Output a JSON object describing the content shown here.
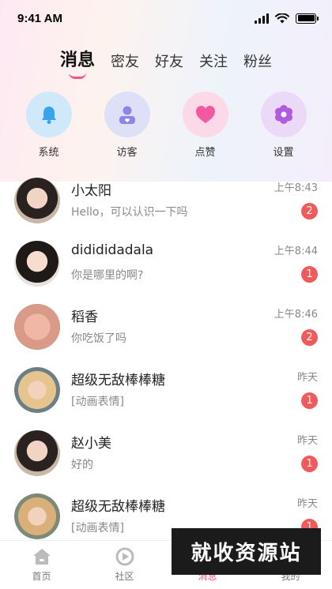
{
  "status_bar": {
    "time": "9:41 AM"
  },
  "tabs": [
    {
      "label": "消息",
      "active": true
    },
    {
      "label": "密友",
      "active": false
    },
    {
      "label": "好友",
      "active": false
    },
    {
      "label": "关注",
      "active": false
    },
    {
      "label": "粉丝",
      "active": false
    }
  ],
  "quick_actions": [
    {
      "label": "系统",
      "icon": "bell-icon"
    },
    {
      "label": "访客",
      "icon": "visitor-icon"
    },
    {
      "label": "点赞",
      "icon": "heart-icon"
    },
    {
      "label": "设置",
      "icon": "gear-icon"
    }
  ],
  "conversations": [
    {
      "name": "小太阳",
      "message": "Hello，可以认识一下吗",
      "time": "上午8:43",
      "unread": "2"
    },
    {
      "name": "didididadala",
      "message": "你是哪里的啊?",
      "time": "上午8:44",
      "unread": "1"
    },
    {
      "name": "稻香",
      "message": "你吃饭了吗",
      "time": "上午8:46",
      "unread": "2"
    },
    {
      "name": "超级无敌棒棒糖",
      "message": "[动画表情]",
      "time": "昨天",
      "unread": "1"
    },
    {
      "name": "赵小美",
      "message": "好的",
      "time": "昨天",
      "unread": "1"
    },
    {
      "name": "超级无敌棒棒糖",
      "message": "[动画表情]",
      "time": "昨天",
      "unread": "1"
    }
  ],
  "tabbar": [
    {
      "label": "首页",
      "icon": "home-icon"
    },
    {
      "label": "社区",
      "icon": "community-icon"
    },
    {
      "label": "消息",
      "icon": "message-icon",
      "active": true
    },
    {
      "label": "我的",
      "icon": "profile-icon"
    }
  ],
  "watermark": "就收资源站",
  "colors": {
    "accent": "#ff4f86",
    "badge": "#f05a5a"
  }
}
